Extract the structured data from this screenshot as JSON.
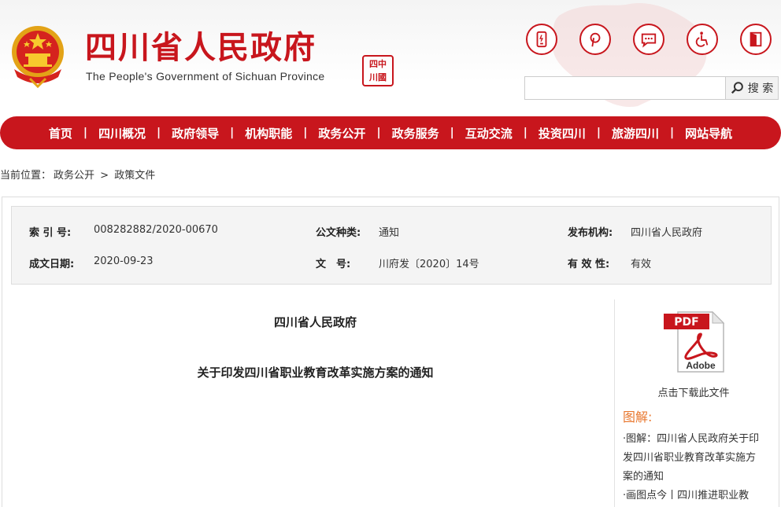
{
  "header": {
    "title": "四川省人民政府",
    "subtitle": "The People's Government of Sichuan Province",
    "seal_text": [
      "中",
      "四",
      "國",
      "川"
    ],
    "tools": [
      {
        "name": "mobile-icon"
      },
      {
        "name": "weibo-icon"
      },
      {
        "name": "message-icon"
      },
      {
        "name": "accessibility-icon"
      },
      {
        "name": "exit-icon"
      }
    ],
    "search": {
      "placeholder": "",
      "button_label": "搜 索"
    }
  },
  "colors": {
    "brand_red": "#c8161d",
    "accent_orange": "#e8772e",
    "meta_bg": "#f4f4f4"
  },
  "nav": {
    "items": [
      "首页",
      "四川概况",
      "政府领导",
      "机构职能",
      "政务公开",
      "政务服务",
      "互动交流",
      "投资四川",
      "旅游四川",
      "网站导航"
    ],
    "separator": "|"
  },
  "breadcrumb": {
    "prefix": "当前位置：",
    "items": [
      "政务公开",
      "政策文件"
    ],
    "separator": ">"
  },
  "meta": {
    "index_label": "索 引 号:",
    "index_value": "008282882/2020-00670",
    "category_label": "公文种类:",
    "category_value": "通知",
    "publisher_label": "发布机构:",
    "publisher_value": "四川省人民政府",
    "date_label": "成文日期:",
    "date_value": "2020-09-23",
    "docno_label": "文　号:",
    "docno_value": "川府发〔2020〕14号",
    "validity_label": "有 效 性:",
    "validity_value": "有效"
  },
  "document": {
    "issuer": "四川省人民政府",
    "title": "关于印发四川省职业教育改革实施方案的通知"
  },
  "sidebar": {
    "pdf_badge": "PDF",
    "pdf_brand": "Adobe",
    "download_caption": "点击下载此文件",
    "heading": "图解:",
    "links": [
      "·图解：四川省人民政府关于印发四川省职业教育改革实施方案的通知",
      "·画图点今丨四川推进职业教"
    ]
  }
}
